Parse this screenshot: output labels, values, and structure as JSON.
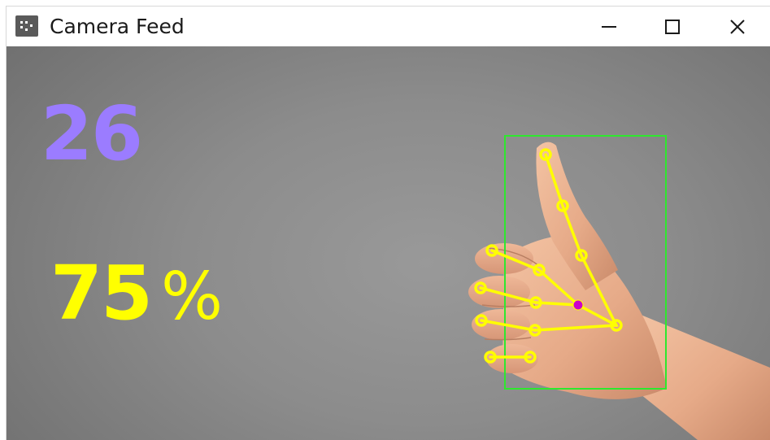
{
  "window": {
    "title": "Camera Feed",
    "icons": {
      "app": "camera-app-icon",
      "minimize": "minimize-icon",
      "maximize": "maximize-icon",
      "close": "close-icon"
    }
  },
  "overlay": {
    "count": "26",
    "count_color": "#9b7cff",
    "percent": "75",
    "percent_sign": "%",
    "percent_color": "#ffff00"
  },
  "detection": {
    "box_color": "#2ee82e",
    "landmark_color": "#ffff00",
    "center_color": "#cc00cc"
  }
}
